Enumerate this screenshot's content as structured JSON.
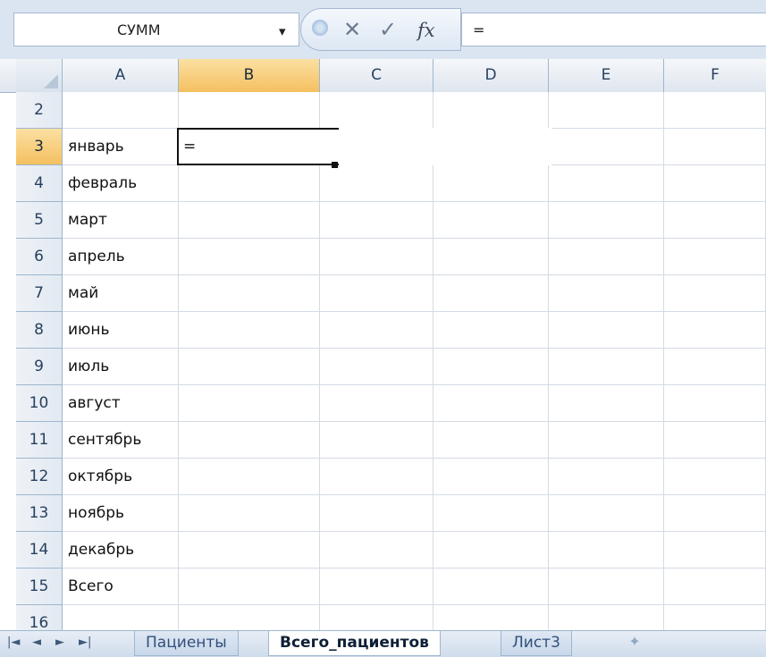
{
  "formula_bar": {
    "name_box": "СУММ",
    "fx_label": "fx",
    "formula": "=",
    "cancel_glyph": "✕",
    "enter_glyph": "✓",
    "dropdown_glyph": "▾"
  },
  "columns": [
    "A",
    "B",
    "C",
    "D",
    "E",
    "F"
  ],
  "selected_column": "B",
  "rows": [
    {
      "num": "2",
      "a": ""
    },
    {
      "num": "3",
      "a": "январь",
      "b": "="
    },
    {
      "num": "4",
      "a": "февраль"
    },
    {
      "num": "5",
      "a": "март"
    },
    {
      "num": "6",
      "a": "апрель"
    },
    {
      "num": "7",
      "a": "май"
    },
    {
      "num": "8",
      "a": "июнь"
    },
    {
      "num": "9",
      "a": "июль"
    },
    {
      "num": "10",
      "a": "август"
    },
    {
      "num": "11",
      "a": "сентябрь"
    },
    {
      "num": "12",
      "a": "октябрь"
    },
    {
      "num": "13",
      "a": "ноябрь"
    },
    {
      "num": "14",
      "a": "декабрь"
    },
    {
      "num": "15",
      "a": "Всего"
    },
    {
      "num": "16",
      "a": ""
    }
  ],
  "selected_row": "3",
  "sheet_tabs": [
    {
      "label": "Пациенты",
      "active": false
    },
    {
      "label": "Всего_пациентов",
      "active": true
    },
    {
      "label": "Лист3",
      "active": false
    }
  ],
  "nav_glyphs": [
    "|◄",
    "◄",
    "►",
    "►|"
  ],
  "colors": {
    "selection_header": "#f4c060",
    "header_bg": "#dfe6ef",
    "grid_line": "#d4dbe4"
  },
  "icons": [
    "close-icon",
    "check-icon",
    "function-icon",
    "new-sheet-icon",
    "dropdown-arrow-icon"
  ]
}
